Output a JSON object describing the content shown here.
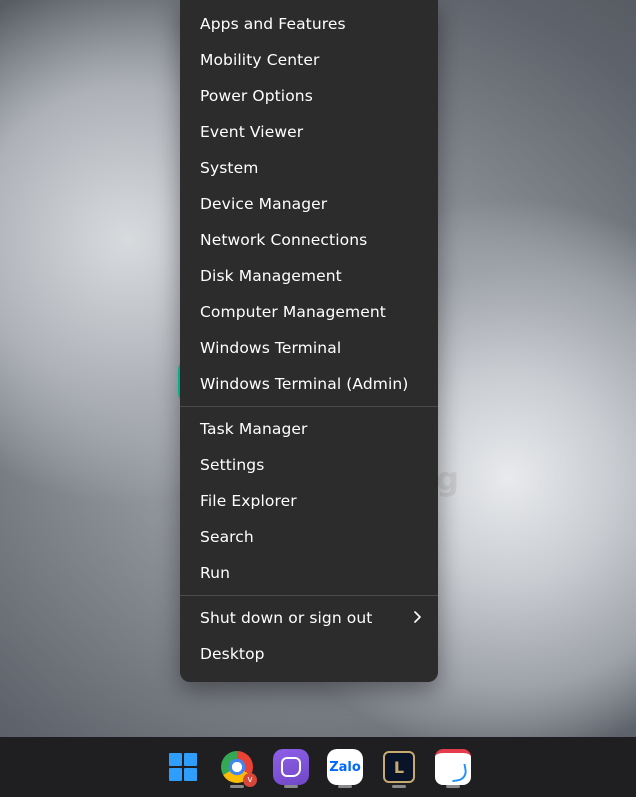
{
  "watermark": "Quantrimang",
  "menu": {
    "groups": [
      [
        "Apps and Features",
        "Mobility Center",
        "Power Options",
        "Event Viewer",
        "System",
        "Device Manager",
        "Network Connections",
        "Disk Management",
        "Computer Management",
        "Windows Terminal",
        "Windows Terminal (Admin)"
      ],
      [
        "Task Manager",
        "Settings",
        "File Explorer",
        "Search",
        "Run"
      ],
      [
        "Shut down or sign out",
        "Desktop"
      ]
    ],
    "highlighted_item": "Windows Terminal",
    "submenu_item": "Shut down or sign out"
  },
  "taskbar": {
    "items": [
      {
        "name": "start",
        "label": "Start",
        "highlighted": true
      },
      {
        "name": "chrome",
        "label": "Google Chrome",
        "badge": "v",
        "running": true
      },
      {
        "name": "viber",
        "label": "Viber",
        "running": true
      },
      {
        "name": "zalo",
        "label": "Zalo",
        "text": "Zalo",
        "running": true
      },
      {
        "name": "league",
        "label": "League of Legends",
        "text": "L",
        "running": true
      },
      {
        "name": "snipping-tool",
        "label": "Snipping Tool",
        "running": true
      }
    ]
  },
  "colors": {
    "highlight": "#00d9a3",
    "menu_bg": "#2c2c2c",
    "taskbar_bg": "#1f1f22"
  }
}
